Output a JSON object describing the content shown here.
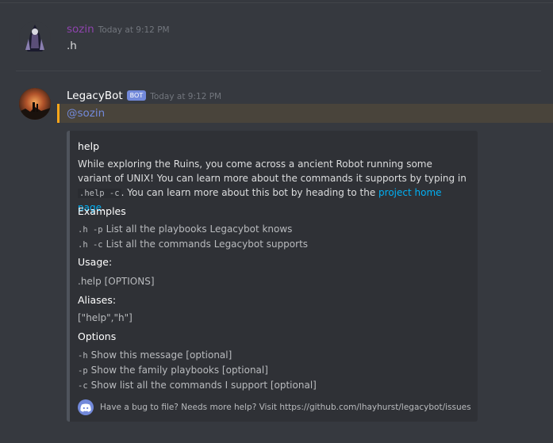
{
  "messages": [
    {
      "username": "sozin",
      "timestamp": "Today at 9:12 PM",
      "text": ".h",
      "username_color": "#8e44ad"
    },
    {
      "username": "LegacyBot",
      "bot_tag": "BOT",
      "timestamp": "Today at 9:12 PM",
      "mention": "@sozin"
    }
  ],
  "embed": {
    "title": "help",
    "description_part1": "While exploring the Ruins, you come across a ancient Robot running some variant of UNIX! You can learn more about the commands it supports by typing in ",
    "description_code": ".help -c",
    "description_part2": ". You can learn more about this bot by heading to the ",
    "description_link": "project home page",
    "description_end": ".",
    "examples_name": "Examples",
    "examples": [
      {
        "code": ".h -p",
        "text": "List all the playbooks Legacybot knows"
      },
      {
        "code": ".h -c",
        "text": "List all the commands Legacybot supports"
      }
    ],
    "usage_name": "Usage:",
    "usage_value": ".help [OPTIONS]",
    "aliases_name": "Aliases:",
    "aliases_value": "[\"help\",\"h\"]",
    "options_name": "Options",
    "options": [
      {
        "code": "-h",
        "text": "Show this message [optional]"
      },
      {
        "code": "-p",
        "text": "Show the family playbooks [optional]"
      },
      {
        "code": "-c",
        "text": "Show list all the commands I support [optional]"
      }
    ],
    "footer": "Have a bug to file? Needs more help? Visit https://github.com/lhayhurst/legacybot/issues",
    "footer_icon": "discord-icon"
  },
  "colors": {
    "background": "#36393f",
    "mention_accent": "#faa61a",
    "bot_tag": "#7289da",
    "link": "#00b0f4"
  }
}
